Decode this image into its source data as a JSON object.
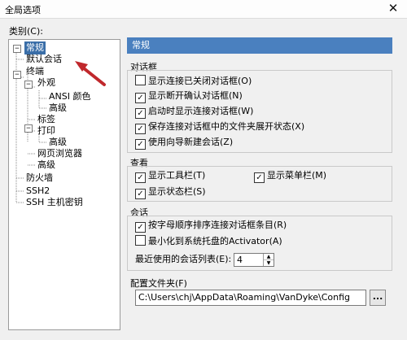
{
  "window": {
    "title": "全局选项",
    "close_glyph": "✕"
  },
  "category_label": "类别(C):",
  "tree": {
    "items": [
      {
        "label": "常规",
        "selected": true,
        "toggle": "−"
      },
      {
        "label": "默认会话"
      },
      {
        "label": "终端",
        "toggle": "−"
      },
      {
        "label": "外观",
        "toggle": "−"
      },
      {
        "label": "ANSI 颜色"
      },
      {
        "label": "高级"
      },
      {
        "label": "标签"
      },
      {
        "label": "打印",
        "toggle": "−"
      },
      {
        "label": "高级"
      },
      {
        "label": "网页浏览器"
      },
      {
        "label": "高级"
      },
      {
        "label": "防火墙"
      },
      {
        "label": "SSH2"
      },
      {
        "label": "SSH 主机密钥"
      }
    ]
  },
  "panel": {
    "header": "常规",
    "dialogs": {
      "title": "对话框",
      "options": [
        {
          "label": "显示连接已关闭对话框(O)",
          "checked": false
        },
        {
          "label": "显示断开确认对话框(N)",
          "checked": true
        },
        {
          "label": "启动时显示连接对话框(W)",
          "checked": true
        },
        {
          "label": "保存连接对话框中的文件夹展开状态(X)",
          "checked": true
        },
        {
          "label": "使用向导新建会话(Z)",
          "checked": true
        }
      ]
    },
    "view": {
      "title": "查看",
      "options": [
        {
          "label": "显示工具栏(T)",
          "checked": true
        },
        {
          "label": "显示菜单栏(M)",
          "checked": true
        },
        {
          "label": "显示状态栏(S)",
          "checked": true
        }
      ]
    },
    "session": {
      "title": "会话",
      "options": [
        {
          "label": "按字母顺序排序连接对话框条目(R)",
          "checked": true
        },
        {
          "label": "最小化到系统托盘的Activator(A)",
          "checked": false
        }
      ],
      "recent_label": "最近使用的会话列表(E):",
      "recent_value": "4"
    },
    "config": {
      "title": "配置文件夹(F)",
      "path": "C:\\Users\\chj\\AppData\\Roaming\\VanDyke\\Config",
      "browse_label": "..."
    }
  },
  "colors": {
    "selection": "#3a6ea8",
    "header": "#4a80bf",
    "arrow": "#c0282c"
  }
}
